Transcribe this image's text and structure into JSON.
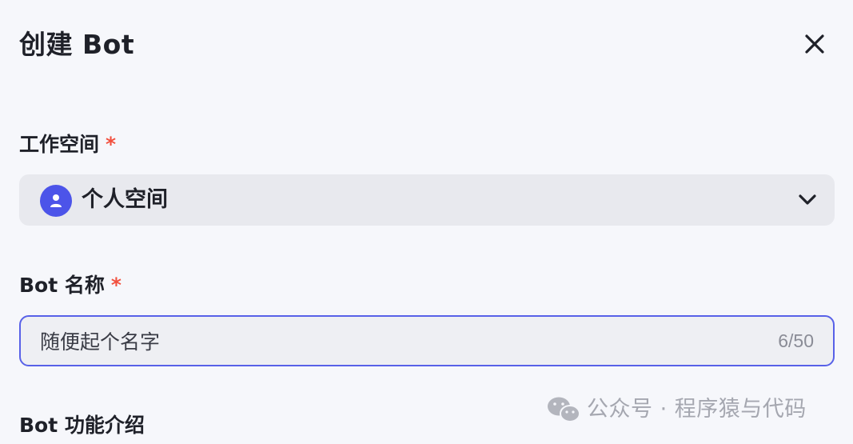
{
  "dialog": {
    "title": "创建 Bot",
    "close_icon": "close-icon"
  },
  "workspace": {
    "label": "工作空间",
    "required_mark": "*",
    "selected": "个人空间",
    "avatar_icon": "user-icon",
    "chevron_icon": "chevron-down-icon",
    "accent_color": "#4c54e9"
  },
  "bot_name": {
    "label": "Bot 名称",
    "required_mark": "*",
    "value": "随便起个名字",
    "counter": "6/50",
    "border_color": "#5861e8"
  },
  "bot_description": {
    "label": "Bot 功能介绍"
  },
  "watermark": {
    "text": "公众号 · 程序猿与代码",
    "icon": "wechat-icon"
  },
  "colors": {
    "required": "#f2503e",
    "background": "#f6f7fb"
  }
}
